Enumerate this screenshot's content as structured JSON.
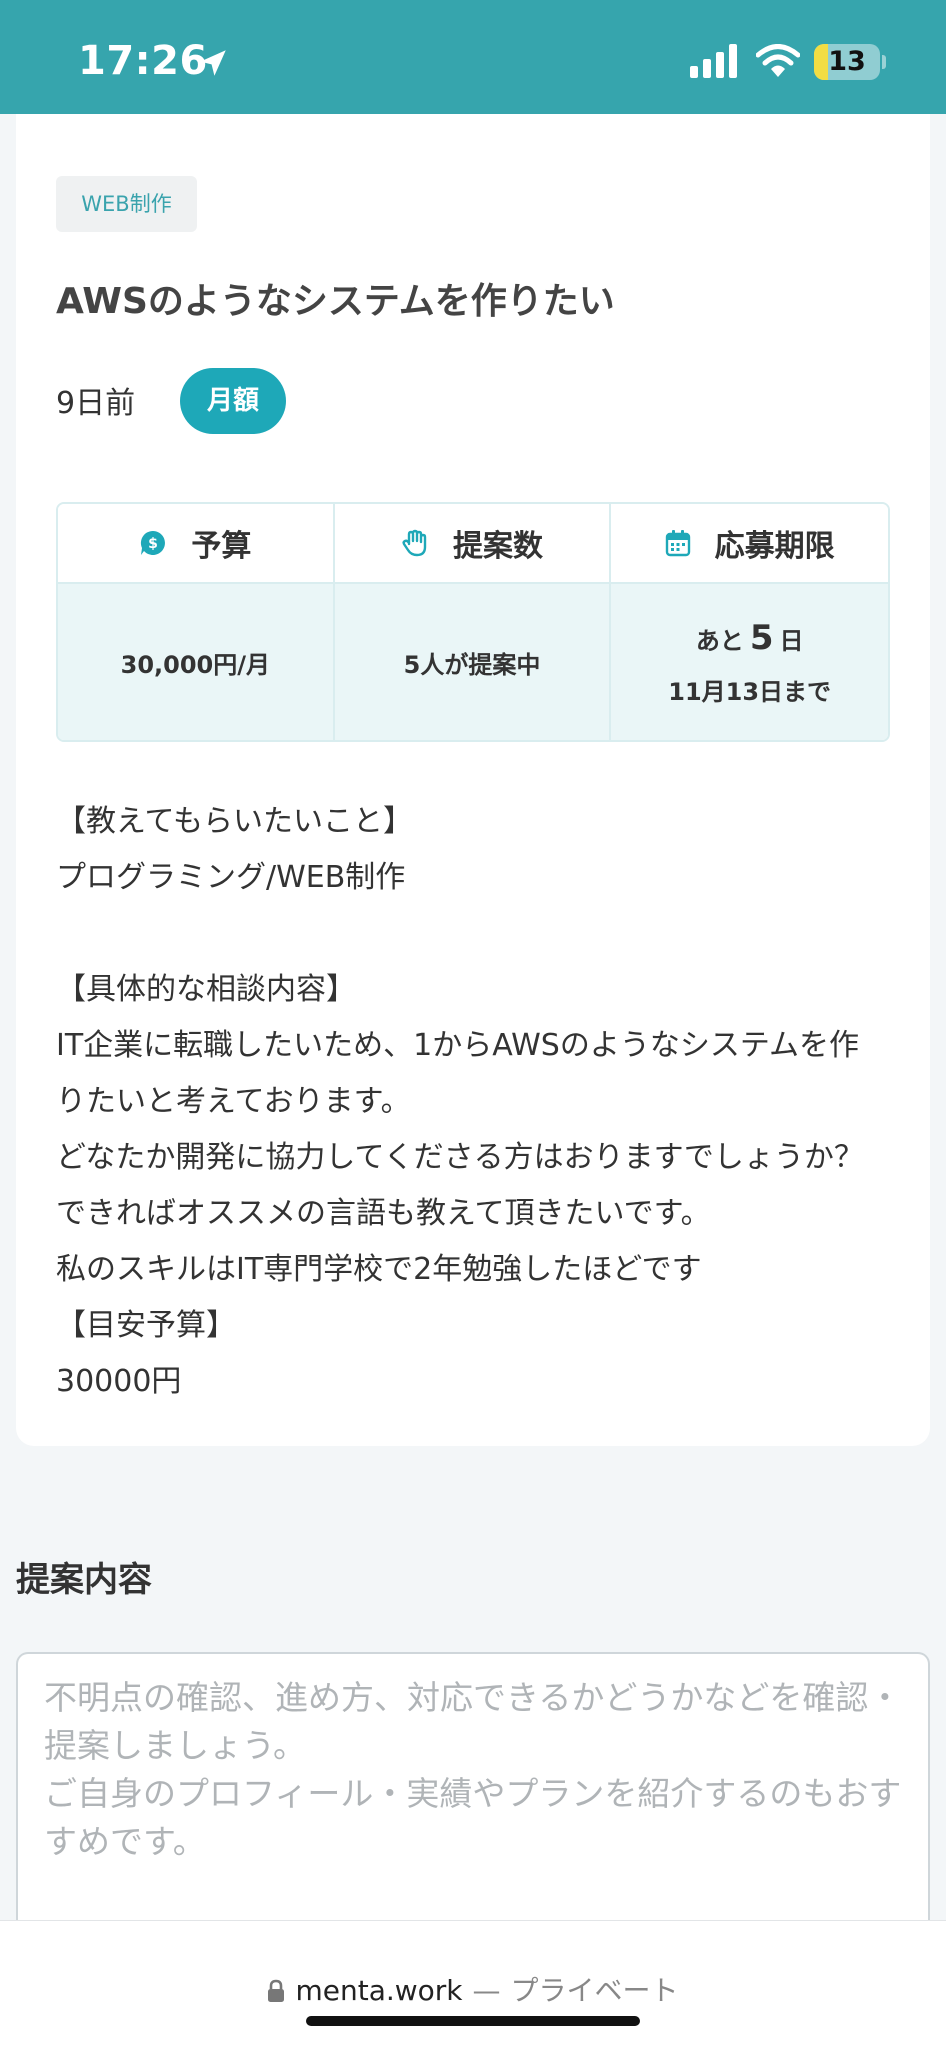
{
  "status_bar": {
    "time": "17:26",
    "battery": "13",
    "icons": [
      "location-arrow-icon",
      "cellular-signal-icon",
      "wifi-icon",
      "battery-icon"
    ]
  },
  "job": {
    "category": "WEB制作",
    "title": "AWSのようなシステムを作りたい",
    "posted": "9日前",
    "pay_type": "月額",
    "info": {
      "budget_label": "予算",
      "budget_value": "30,000円/月",
      "proposals_label": "提案数",
      "proposals_value": "5人が提案中",
      "deadline_label": "応募期限",
      "deadline_prefix": "あと",
      "deadline_days": "5",
      "deadline_suffix": "日",
      "deadline_date": "11月13日まで"
    },
    "description": [
      "【教えてもらいたいこと】",
      "プログラミング/WEB制作",
      "",
      "【具体的な相談内容】",
      "IT企業に転職したいため、1からAWSのようなシステムを作",
      "りたいと考えております。",
      "どなたか開発に協力してくださる方はおりますでしょうか？",
      "できればオススメの言語も教えて頂きたいです。",
      "私のスキルはIT専門学校で2年勉強したほどです",
      "【目安予算】",
      "30000円"
    ]
  },
  "proposal": {
    "section_title": "提案内容",
    "placeholder": "不明点の確認、進め方、対応できるかどうかなどを確認・提案しましょう。\nご自身のプロフィール・実績やプランを紹介するのもおすすめです。"
  },
  "browser": {
    "domain": "menta.work",
    "separator": "—",
    "mode": "プライベート"
  },
  "colors": {
    "status_bar": "#36a5ad",
    "accent": "#1ea8b8",
    "table_body": "#eaf6f7"
  }
}
